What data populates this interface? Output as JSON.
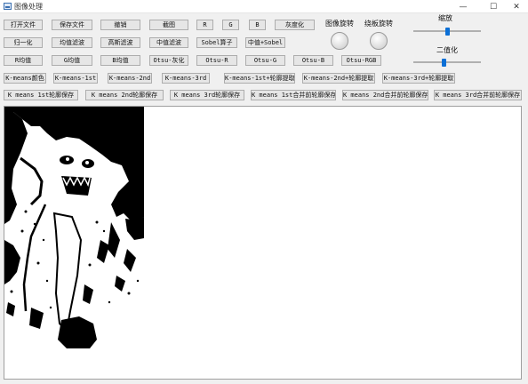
{
  "window": {
    "title": "图像处理",
    "minimize_glyph": "—",
    "maximize_glyph": "☐",
    "close_glyph": "✕"
  },
  "toolbar": {
    "row1": [
      "打开文件",
      "保存文件",
      "撤销",
      "截图",
      "R",
      "G",
      "B",
      "灰度化"
    ],
    "row2": [
      "归一化",
      "均值滤波",
      "高斯滤波",
      "中值滤波",
      "Sobel算子",
      "中值+Sobel"
    ],
    "row3": [
      "R均值",
      "G均值",
      "B均值",
      "Otsu-灰化",
      "Otsu-R",
      "Otsu-G",
      "Otsu-B",
      "Otsu-RGB"
    ],
    "row4": [
      "K-means颜色",
      "K-means-1st",
      "K-means-2nd",
      "K-means-3rd",
      "K-means-1st+轮廓提取",
      "K-means-2nd+轮廓提取",
      "K-means-3rd+轮廓提取"
    ],
    "row5": [
      "K means 1st轮廓保存",
      "K means 2nd轮廓保存",
      "K means 3rd轮廓保存",
      "K means 1st合并前轮廓保存",
      "K means 2nd合并前轮廓保存",
      "K means 3rd合并前轮廓保存"
    ]
  },
  "controls": {
    "rotate_image_label": "图像旋转",
    "rotate_canvas_label": "绕板旋转",
    "scale_label": "缩放",
    "binarize_label": "二值化",
    "scale_value": 0.5,
    "binarize_value": 0.45
  },
  "colors": {
    "accent": "#0b6fd6",
    "button_bg": "#e6e6e6",
    "button_border": "#adadad",
    "window_bg": "#f0f0f0"
  },
  "icons": {
    "app": "image-app-icon"
  }
}
